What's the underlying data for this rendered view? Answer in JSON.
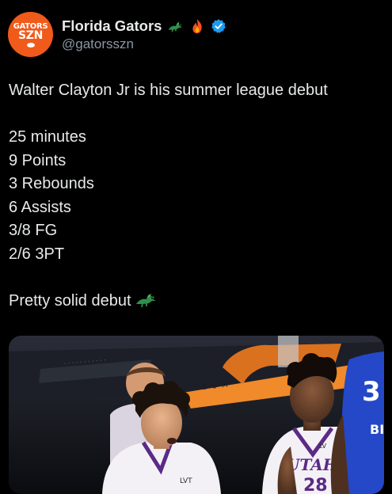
{
  "post": {
    "author": {
      "display_name": "Florida Gators",
      "handle": "@gatorsszn",
      "avatar_text_line1": "GATORS",
      "avatar_text_line2": "SZN",
      "name_emojis": [
        "gator-emoji",
        "fire-emoji"
      ],
      "verified": true,
      "avatar_color": "#f05a1a"
    },
    "body": {
      "headline": "Walter Clayton Jr is his summer league debut",
      "stats": [
        "25 minutes",
        "9 Points",
        "3 Rebounds",
        "6 Assists",
        "3/8 FG",
        "2/6 3PT"
      ],
      "closing": "Pretty solid debut"
    },
    "media": {
      "banner_text": "SUM",
      "jersey_left": "LVT",
      "jersey_right_team": "UTAH",
      "jersey_right_number": "28",
      "jersey_right_logo": "LV",
      "jersey_far_right_number": "3",
      "jersey_far_right_text": "BI"
    }
  },
  "colors": {
    "background": "#000000",
    "text_primary": "#e7e9ea",
    "text_secondary": "#8b98a5",
    "verified_blue": "#1d9bf0",
    "gator_green": "#2f8f4a"
  }
}
